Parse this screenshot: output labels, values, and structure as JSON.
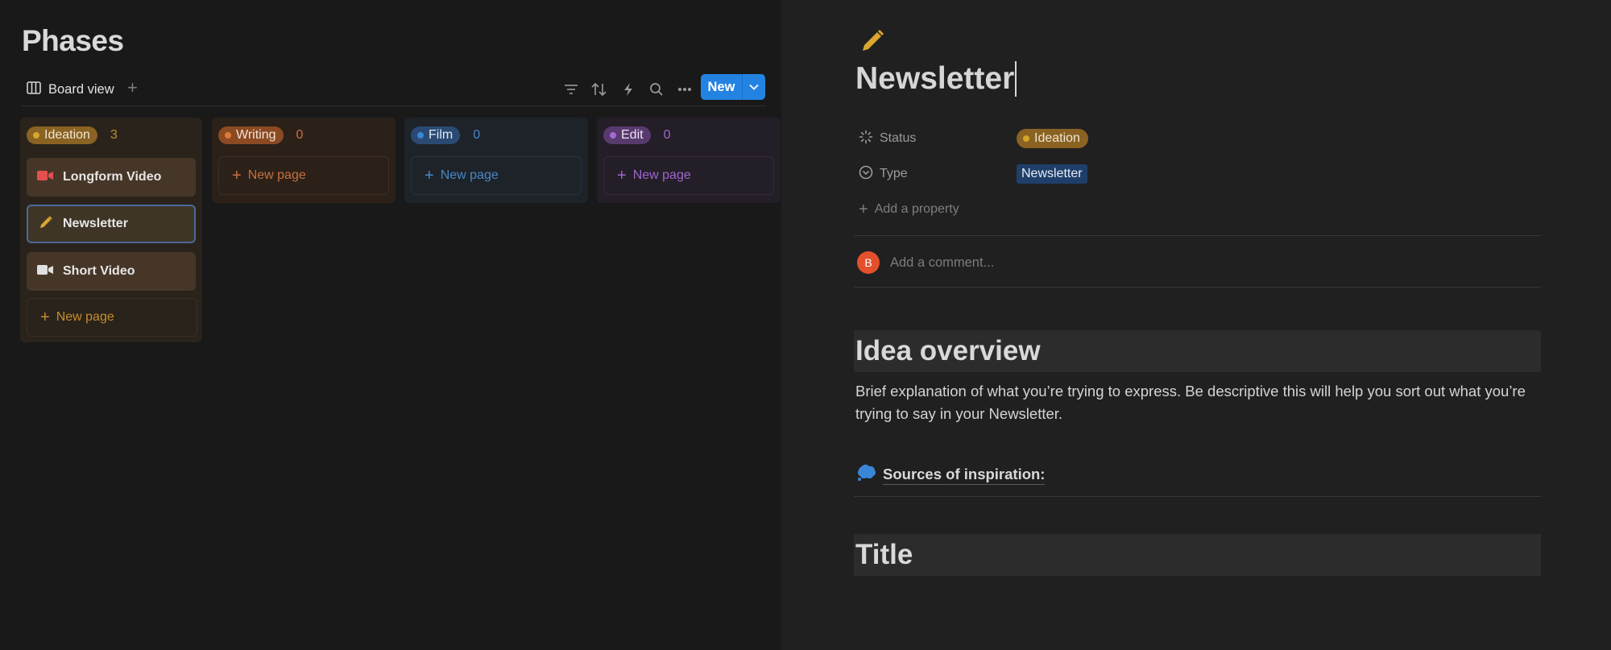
{
  "board": {
    "title": "Phases",
    "view_label": "Board view",
    "add_view": "+",
    "new_button": "New",
    "columns": [
      {
        "label": "Ideation",
        "count": "3",
        "color": "#d29b2a",
        "cards": [
          {
            "title": "Longform Video",
            "icon": "video-camera-red-icon"
          },
          {
            "title": "Newsletter",
            "icon": "pencil-icon"
          },
          {
            "title": "Short Video",
            "icon": "video-camera-white-icon"
          }
        ],
        "new_page": "New page"
      },
      {
        "label": "Writing",
        "count": "0",
        "color": "#d6733a",
        "new_page": "New page"
      },
      {
        "label": "Film",
        "count": "0",
        "color": "#3a86d6",
        "new_page": "New page"
      },
      {
        "label": "Edit",
        "count": "0",
        "color": "#9b5fd0",
        "new_page": "New page"
      }
    ]
  },
  "page": {
    "icon": "pencil-icon",
    "title": "Newsletter",
    "properties": {
      "status_label": "Status",
      "status_value": "Ideation",
      "type_label": "Type",
      "type_value": "Newsletter",
      "add_property": "Add a property"
    },
    "comment": {
      "avatar": "B",
      "placeholder": "Add a comment..."
    },
    "heading1": "Idea overview",
    "paragraph": "Brief explanation of what you’re trying to express. Be descriptive this will help you sort out what you’re trying to say in your Newsletter.",
    "sources_label": "Sources of inspiration:",
    "heading2": "Title"
  }
}
